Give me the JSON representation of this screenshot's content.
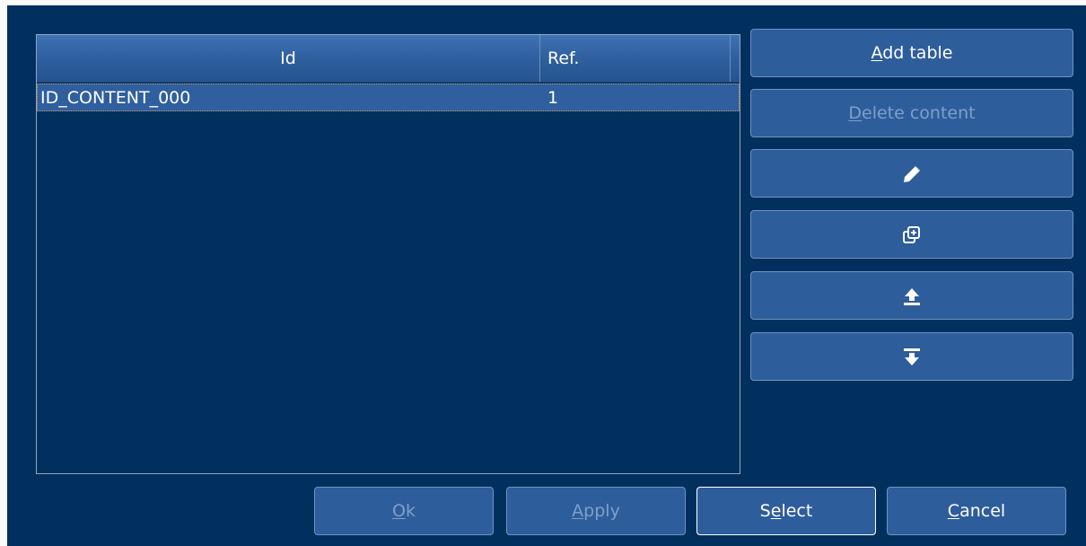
{
  "table": {
    "columns": [
      "Id",
      "Ref."
    ],
    "rows": [
      {
        "id": "ID_CONTENT_000",
        "ref": "1",
        "selected": true
      }
    ]
  },
  "side_buttons": {
    "add_table": {
      "mnemonic": "A",
      "rest": "dd table",
      "enabled": true
    },
    "delete_content": {
      "mnemonic": "D",
      "rest": "elete content",
      "enabled": false
    },
    "edit": {
      "icon": "pencil-icon",
      "enabled": true
    },
    "duplicate": {
      "icon": "duplicate-plus-icon",
      "enabled": true
    },
    "move_up": {
      "icon": "move-to-top-icon",
      "enabled": true
    },
    "move_down": {
      "icon": "move-to-bottom-icon",
      "enabled": true
    }
  },
  "bottom_buttons": {
    "ok": {
      "mnemonic": "O",
      "rest": "k",
      "enabled": false
    },
    "apply": {
      "mnemonic": "A",
      "rest": "pply",
      "enabled": false
    },
    "select": {
      "pre": "S",
      "mnemonic": "e",
      "rest": "lect",
      "enabled": true,
      "focused": true
    },
    "cancel": {
      "mnemonic": "C",
      "rest": "ancel",
      "enabled": true
    }
  },
  "colors": {
    "background": "#02305e",
    "button": "#2e5d9c",
    "header": "#3e72b4",
    "selection": "#2f5f9e",
    "text": "#ffffff",
    "disabled_text": "#7f9fc9"
  }
}
